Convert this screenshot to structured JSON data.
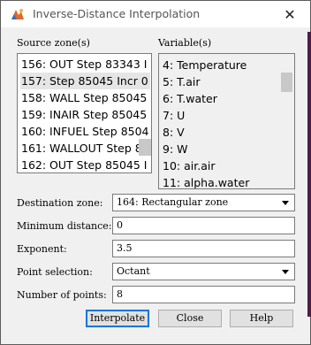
{
  "window": {
    "title": "Inverse-Distance Interpolation",
    "close_glyph": "✕"
  },
  "source_zones": {
    "label": "Source zone(s)",
    "items": [
      "156: OUT Step 83343 I",
      "157: Step 85045 Incr 0",
      "158: WALL Step 85045",
      "159: INAIR Step 85045",
      "160: INFUEL Step 8504",
      "161: WALLOUT Step 85",
      "162: OUT Step 85045 I"
    ],
    "selected_index": 1
  },
  "variables": {
    "label": "Variable(s)",
    "items": [
      "4: Temperature",
      "5: T.air",
      "6: T.water",
      "7: U",
      "8: V",
      "9: W",
      "10: air.air",
      "11: alpha.water"
    ]
  },
  "destination_zone": {
    "label": "Destination zone:",
    "value": "164: Rectangular zone"
  },
  "minimum_distance": {
    "label": "Minimum distance:",
    "value": "0"
  },
  "exponent": {
    "label": "Exponent:",
    "value": "3.5"
  },
  "point_selection": {
    "label": "Point selection:",
    "value": "Octant"
  },
  "number_of_points": {
    "label": "Number of points:",
    "value": "8"
  },
  "buttons": {
    "interpolate": "Interpolate",
    "close": "Close",
    "help": "Help"
  },
  "colors": {
    "dialog_bg": "#f0f0f0",
    "selection": "#e5e5e5",
    "accent_border": "#0078d7",
    "edge_strip": "#4b1f46"
  }
}
